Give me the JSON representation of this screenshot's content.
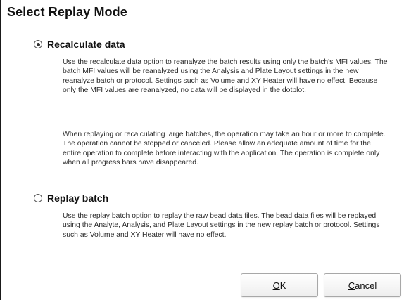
{
  "dialog": {
    "title": "Select Replay Mode",
    "options": [
      {
        "label": "Recalculate data",
        "selected": true,
        "paragraphs": [
          "Use the recalculate data option to reanalyze the batch results using only the batch's MFI values.  The batch MFI values will be reanalyzed using the Analysis and Plate Layout settings in the new reanalyze batch or protocol.  Settings such as Volume and XY Heater will have no effect.  Because only the MFI values are reanalyzed, no data will be displayed in the dotplot.",
          "When replaying or recalculating large batches, the operation may take an hour or more to complete.  The operation cannot be stopped or canceled.  Please allow an adequate amount of time for the entire operation to complete before interacting with the application.  The operation is complete only when all progress bars have disappeared."
        ]
      },
      {
        "label": "Replay batch",
        "selected": false,
        "paragraphs": [
          "Use the replay batch option to replay the raw bead data files.  The bead data files will be replayed using the Analyte, Analysis, and Plate Layout settings in the new replay batch or protocol.  Settings such as Volume and XY Heater will have no effect."
        ]
      }
    ],
    "buttons": {
      "ok": {
        "mnemonic": "O",
        "rest": "K"
      },
      "cancel": {
        "mnemonic": "C",
        "rest": "ancel"
      }
    }
  }
}
